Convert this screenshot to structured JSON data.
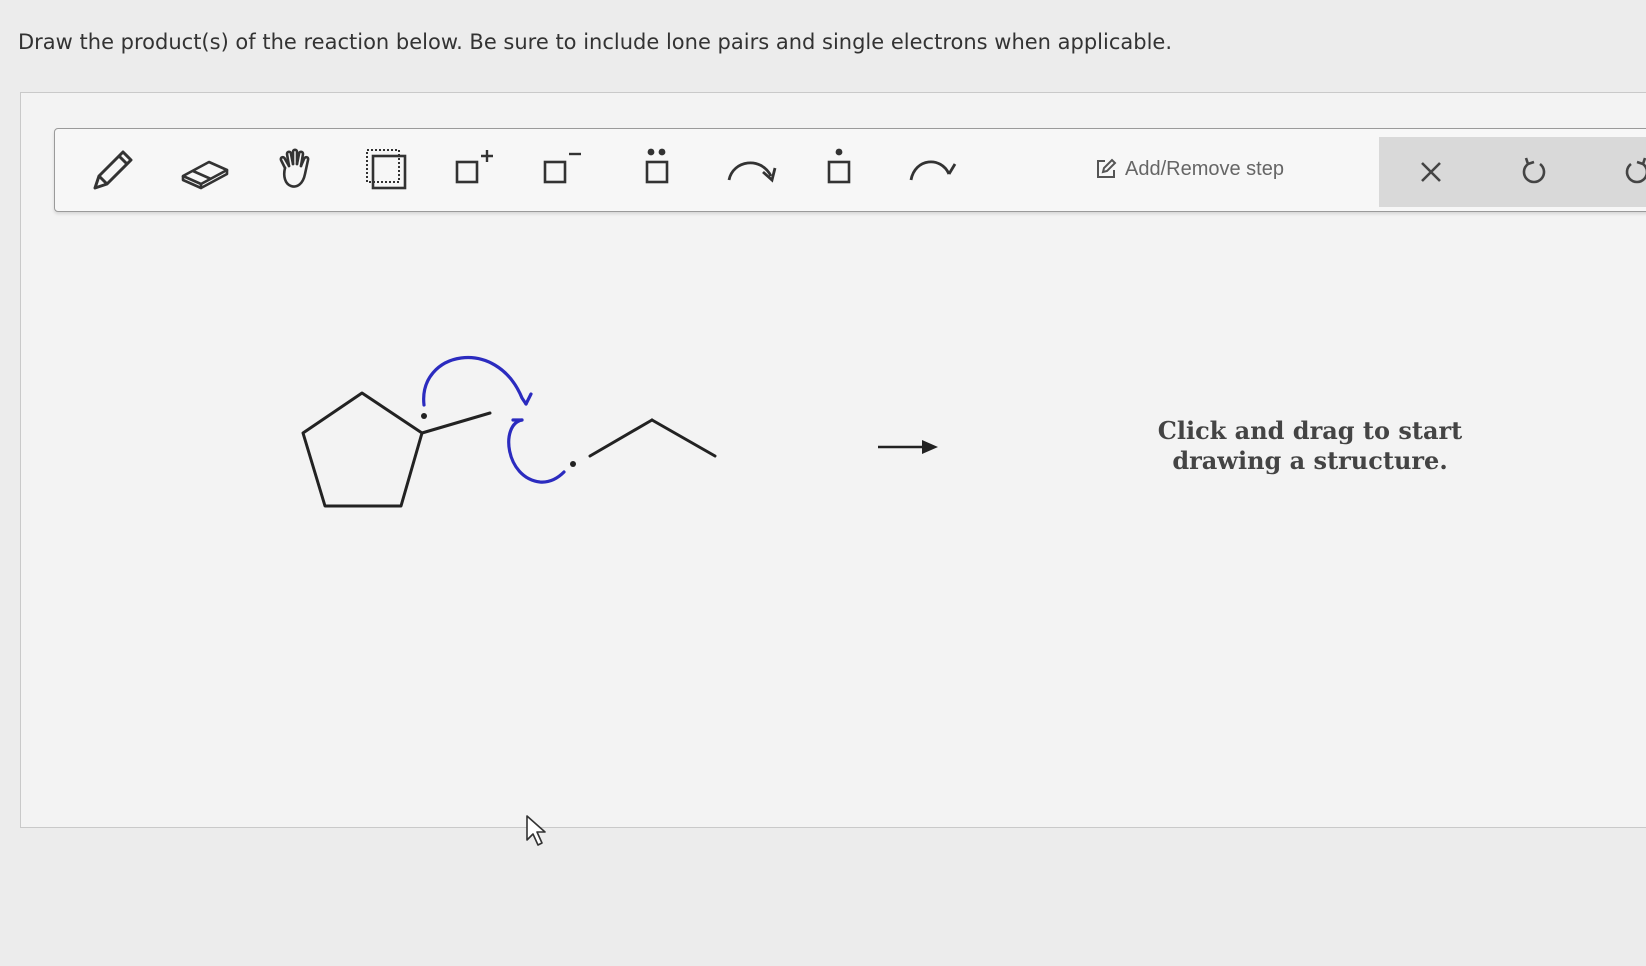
{
  "question": {
    "text": "Draw the product(s) of the reaction below. Be sure to include lone pairs and single electrons when applicable."
  },
  "toolbar": {
    "tools": [
      {
        "icon": "pencil-icon"
      },
      {
        "icon": "eraser-icon"
      },
      {
        "icon": "hand-icon"
      },
      {
        "icon": "select-box-icon"
      },
      {
        "icon": "positive-charge-icon"
      },
      {
        "icon": "negative-charge-icon"
      },
      {
        "icon": "lone-pair-icon"
      },
      {
        "icon": "electron-pair-arrow-icon"
      },
      {
        "icon": "single-electron-icon"
      },
      {
        "icon": "single-electron-arrow-icon"
      }
    ],
    "add_remove_label": "Add/Remove step",
    "close_icon": "close-icon",
    "undo_icon": "undo-icon",
    "redo_icon": "redo-icon"
  },
  "canvas": {
    "hint": "Click and drag to start drawing a structure.",
    "arrow_color": "#2b2bbf"
  }
}
